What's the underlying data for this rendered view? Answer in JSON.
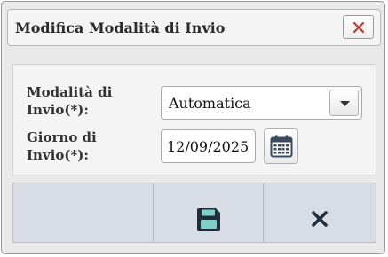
{
  "dialog": {
    "title": "Modifica Modalità di Invio",
    "close_icon": "close-x-icon"
  },
  "form": {
    "modalita": {
      "label_line1": "Modalità di",
      "label_line2": "Invio(*):",
      "selected_value": "Automatica",
      "arrow_icon": "caret-down-icon"
    },
    "giorno": {
      "label_line1": "Giorno di",
      "label_line2": "Invio(*):",
      "value": "12/09/2025",
      "calendar_icon": "calendar-icon"
    }
  },
  "actions": {
    "save_icon": "floppy-disk-icon",
    "cancel_icon": "close-x-icon"
  },
  "colors": {
    "close_red": "#c0392b",
    "save_icon_fill": "#1f2d3d",
    "save_icon_accent": "#7fd1c7",
    "button_bar_bg": "#d8dce5"
  }
}
